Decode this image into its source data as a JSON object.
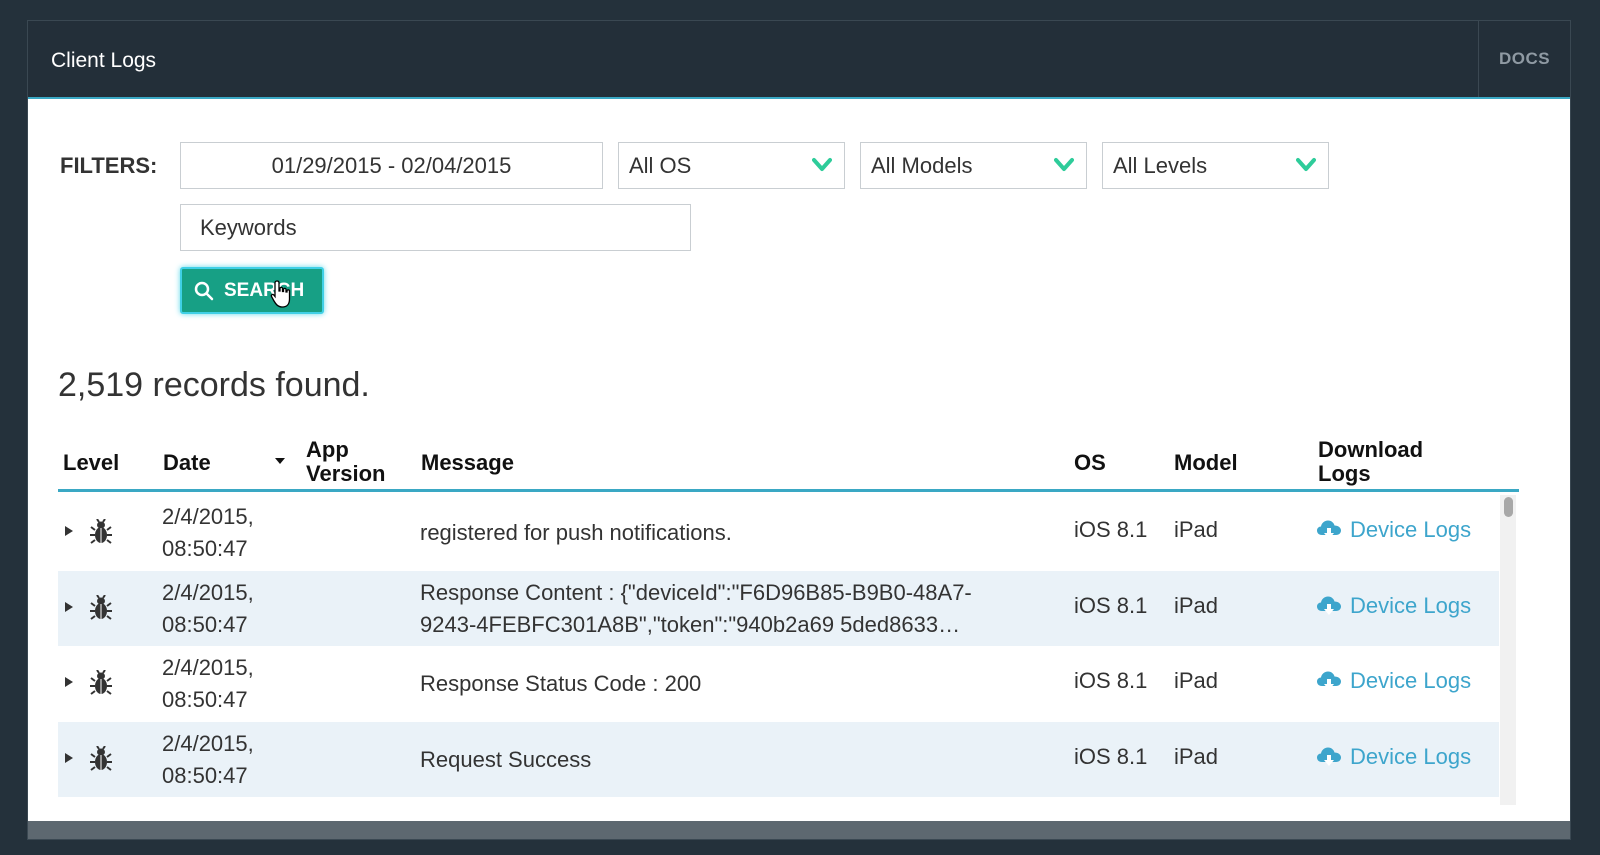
{
  "header": {
    "title": "Client Logs",
    "docs_label": "DOCS"
  },
  "filters": {
    "label": "FILTERS:",
    "date_range": "01/29/2015 - 02/04/2015",
    "os_selected": "All OS",
    "models_selected": "All Models",
    "levels_selected": "All Levels",
    "keywords_placeholder": "Keywords",
    "search_label": "SEARCH"
  },
  "records_found": "2,519 records found.",
  "table": {
    "columns": {
      "level": "Level",
      "date": "Date",
      "app_version": "App Version",
      "message": "Message",
      "os": "OS",
      "model": "Model",
      "download": "Download Logs"
    },
    "rows": [
      {
        "date": "2/4/2015,",
        "time": "08:50:47",
        "message": "registered for push notifications.",
        "message2": "",
        "os": "iOS 8.1",
        "model": "iPad",
        "download": "Device Logs"
      },
      {
        "date": "2/4/2015,",
        "time": "08:50:47",
        "message": "Response Content : {\"deviceId\":\"F6D96B85-B9B0-48A7-",
        "message2": "9243-4FEBFC301A8B\",\"token\":\"940b2a69 5ded8633…",
        "os": "iOS 8.1",
        "model": "iPad",
        "download": "Device Logs"
      },
      {
        "date": "2/4/2015,",
        "time": "08:50:47",
        "message": "Response Status Code : 200",
        "message2": "",
        "os": "iOS 8.1",
        "model": "iPad",
        "download": "Device Logs"
      },
      {
        "date": "2/4/2015,",
        "time": "08:50:47",
        "message": "Request Success",
        "message2": "",
        "os": "iOS 8.1",
        "model": "iPad",
        "download": "Device Logs"
      }
    ]
  },
  "colors": {
    "accent": "#3aa8c4",
    "search_button": "#17a085",
    "chevron": "#2ecc9a",
    "link": "#3da5cc",
    "row_alt": "#eaf2f8"
  },
  "icons": [
    "search-icon",
    "chevron-down-icon",
    "bug-icon",
    "cloud-download-icon",
    "expand-arrow-icon",
    "sort-caret-icon",
    "hand-cursor-icon"
  ]
}
